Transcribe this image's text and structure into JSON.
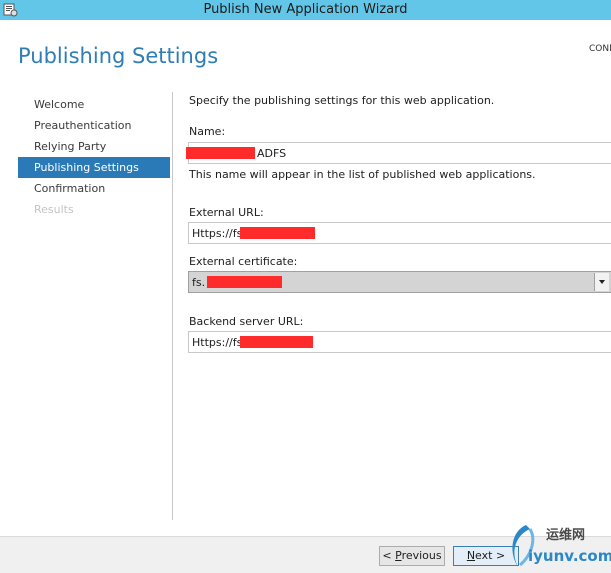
{
  "window": {
    "title": "Publish New Application Wizard",
    "icon": "wizard-app-icon"
  },
  "header": {
    "title": "Publishing Settings",
    "connection_label": "CONN"
  },
  "nav": {
    "items": [
      {
        "label": "Welcome",
        "state": "normal"
      },
      {
        "label": "Preauthentication",
        "state": "normal"
      },
      {
        "label": "Relying Party",
        "state": "normal"
      },
      {
        "label": "Publishing Settings",
        "state": "active"
      },
      {
        "label": "Confirmation",
        "state": "normal"
      },
      {
        "label": "Results",
        "state": "disabled"
      }
    ]
  },
  "form": {
    "description": "Specify the publishing settings for this web application.",
    "name": {
      "label": "Name:",
      "value_suffix": "ADFS",
      "hint": "This name will appear in the list of published web applications."
    },
    "external_url": {
      "label": "External URL:",
      "value_prefix": "Https://fs."
    },
    "external_certificate": {
      "label": "External certificate:",
      "value_prefix": "fs."
    },
    "backend_url": {
      "label": "Backend server URL:",
      "value_prefix": "Https://fs."
    }
  },
  "buttons": {
    "previous": {
      "mnemonic": "P",
      "rest": "revious",
      "prefix": "< "
    },
    "next": {
      "mnemonic": "N",
      "rest": "ext >"
    }
  },
  "watermark": {
    "text_cn": "运维网",
    "text_en": "iyunv.com"
  },
  "colors": {
    "titlebar": "#62c6e8",
    "accent": "#2a7ab8",
    "heading": "#2e7db6",
    "redaction": "#ff2a2a"
  }
}
